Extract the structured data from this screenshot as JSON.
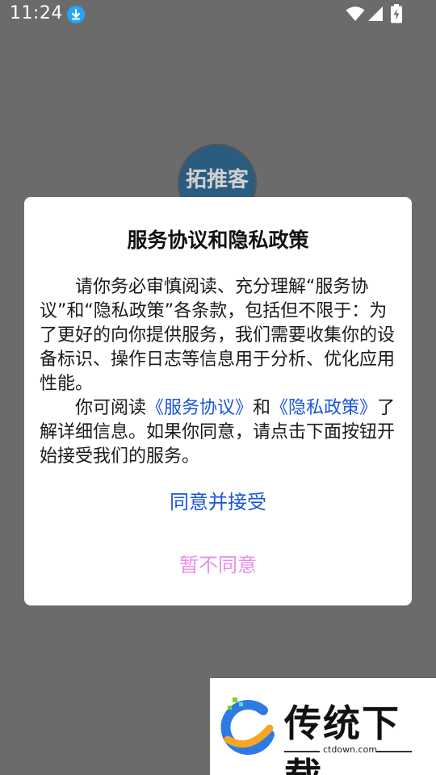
{
  "status_bar": {
    "time": "11:24"
  },
  "background_app": {
    "logo_text": "拓推客"
  },
  "dialog": {
    "title": "服务协议和隐私政策",
    "paragraph1": "请你务必审慎阅读、充分理解“服务协议”和“隐私政策”各条款，包括但不限于：为了更好的向你提供服务，我们需要收集你的设备标识、操作日志等信息用于分析、优化应用性能。",
    "paragraph2_prefix": "你可阅读",
    "service_agreement_link": "《服务协议》",
    "paragraph2_and": "和",
    "privacy_policy_link": "《隐私政策》",
    "paragraph2_suffix": "了解详细信息。如果你同意，请点击下面按钮开始接受我们的服务。",
    "agree_label": "同意并接受",
    "disagree_label": "暂不同意"
  },
  "watermark": {
    "brand": "传统下载",
    "url": "ctdown.com"
  },
  "icons": {
    "download": "download-icon",
    "wifi": "wifi-icon",
    "signal": "signal-icon",
    "battery": "battery-charging-icon"
  },
  "colors": {
    "overlay": "#6b6b6b",
    "link": "#1a56d6",
    "agree": "#1a56d6",
    "disagree": "#e98ee9",
    "download_badge": "#22a6f5"
  }
}
